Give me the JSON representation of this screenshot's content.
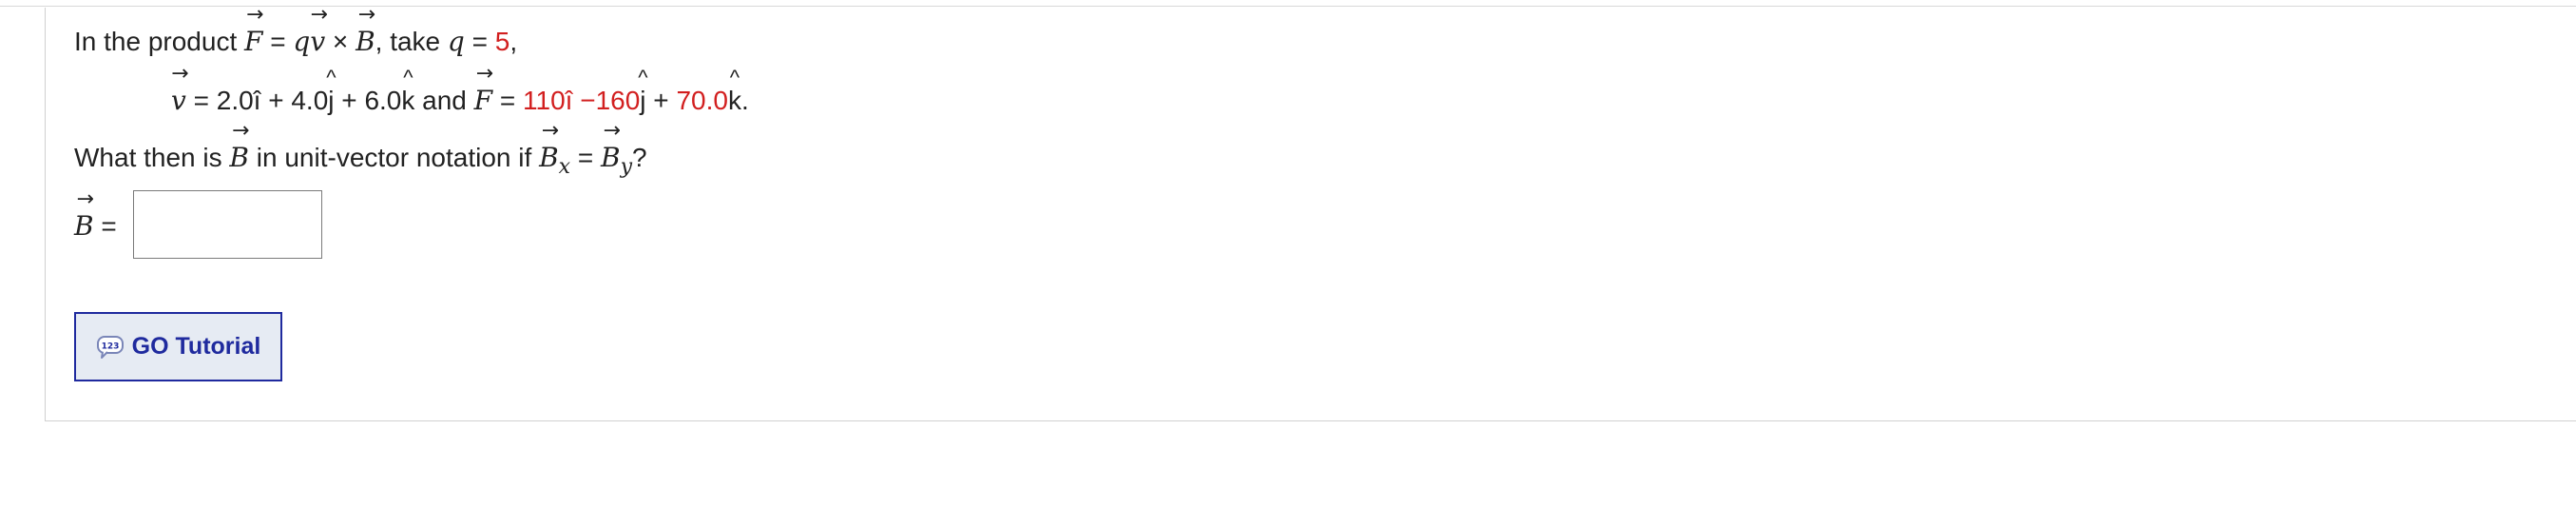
{
  "problem": {
    "intro": "In the product",
    "eq": "=",
    "q_sym": "q",
    "times": "×",
    "take_text": ", take",
    "q_value": "5",
    "comma": ",",
    "F_sym": "F",
    "v_sym": "v",
    "B_sym": "B",
    "arrow": "→",
    "v_components": "2.0î + 4.0",
    "j_hat": "j",
    "hat": "^",
    "v_k_part": " + 6.0",
    "k_letter": "k",
    "and_text": " and ",
    "F_x": "110î",
    "F_y": "−160",
    "plus": " + ",
    "F_z": "70.0",
    "period": ".",
    "question_start": "What then is",
    "question_mid": "in unit-vector notation if",
    "sub_x": "x",
    "sub_y": "y",
    "qmark": "?"
  },
  "answer": {
    "label_eq": "=",
    "value": ""
  },
  "tutorial_button": {
    "label": "GO Tutorial",
    "icon": "tutorial-123-icon",
    "icon_text": "123"
  },
  "colors": {
    "red_values": "#d21f1f",
    "button_text": "#1f2a9e",
    "button_bg": "#e6ebf3"
  }
}
